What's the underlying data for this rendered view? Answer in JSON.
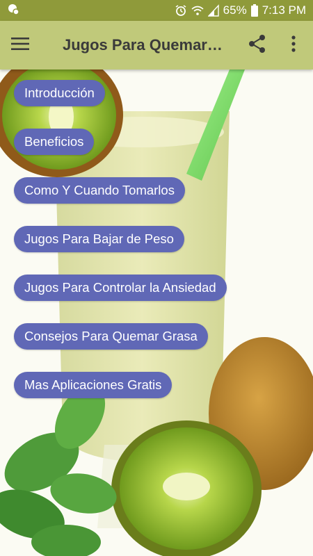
{
  "status_bar": {
    "battery": "65%",
    "time": "7:13 PM",
    "icons": [
      "notification-icon",
      "alarm-icon",
      "wifi-icon",
      "signal-icon",
      "battery-icon"
    ]
  },
  "app_bar": {
    "title": "Jugos Para Quemar…",
    "icons": [
      "menu-icon",
      "share-icon",
      "more-vert-icon"
    ]
  },
  "menu": {
    "items": [
      {
        "label": "Introducción"
      },
      {
        "label": "Beneficios"
      },
      {
        "label": "Como Y Cuando Tomarlos"
      },
      {
        "label": "Jugos Para Bajar de Peso"
      },
      {
        "label": "Jugos Para Controlar la Ansiedad"
      },
      {
        "label": "Consejos Para Quemar Grasa"
      },
      {
        "label": "Mas Aplicaciones Gratis"
      }
    ]
  },
  "colors": {
    "status_bar": "#8f9a3a",
    "app_bar": "#c0c97a",
    "pill": "#6068b6",
    "pill_text": "#ffffff"
  }
}
